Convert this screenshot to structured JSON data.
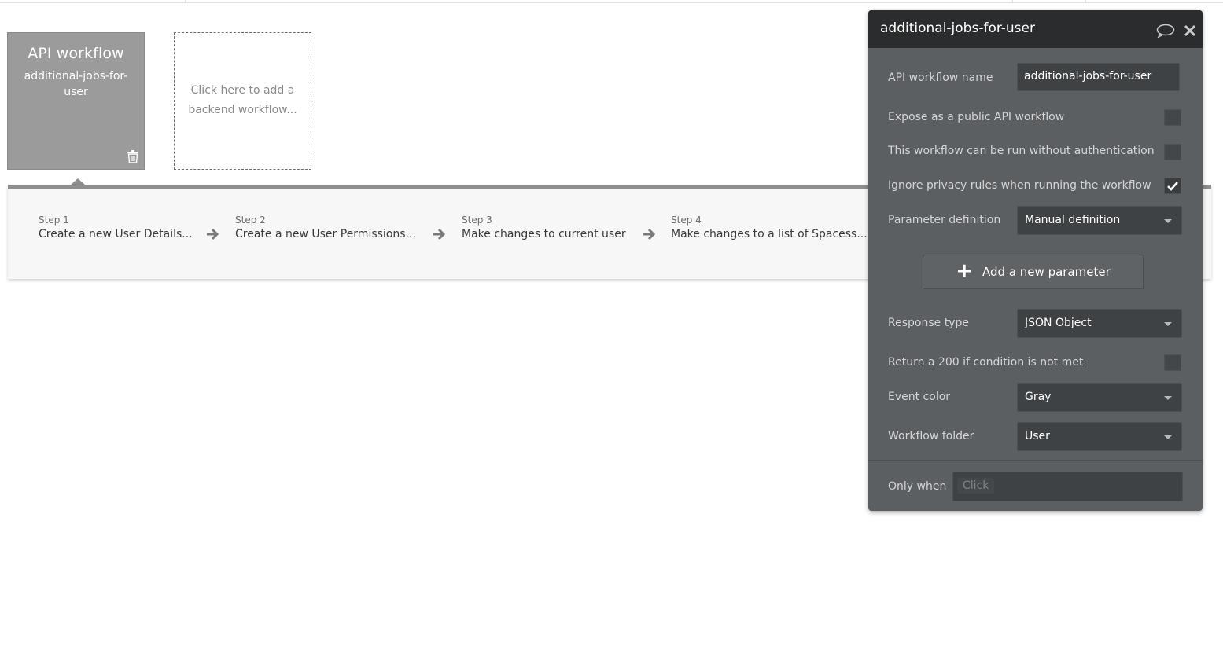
{
  "workflow_card": {
    "title": "API workflow",
    "name": "additional-jobs-for-user"
  },
  "add_card": {
    "label": "Click here to add a backend workflow..."
  },
  "steps": [
    {
      "num": "Step 1",
      "text": "Create a new User Details..."
    },
    {
      "num": "Step 2",
      "text": "Create a new User Permissions..."
    },
    {
      "num": "Step 3",
      "text": "Make changes to current user"
    },
    {
      "num": "Step 4",
      "text": "Make changes to a list of Spacess..."
    }
  ],
  "panel": {
    "title": "additional-jobs-for-user",
    "name_label": "API workflow name",
    "name_value": "additional-jobs-for-user",
    "expose_label": "Expose as a public API workflow",
    "expose_checked": false,
    "no_auth_label": "This workflow can be run without authentication",
    "no_auth_checked": false,
    "privacy_label": "Ignore privacy rules when running the workflow",
    "privacy_checked": true,
    "param_def_label": "Parameter definition",
    "param_def_value": "Manual definition",
    "add_param_label": "Add a new parameter",
    "response_label": "Response type",
    "response_value": "JSON Object",
    "return200_label": "Return a 200 if condition is not met",
    "return200_checked": false,
    "event_color_label": "Event color",
    "event_color_value": "Gray",
    "folder_label": "Workflow folder",
    "folder_value": "User",
    "only_when_label": "Only when",
    "only_when_placeholder": "Click"
  },
  "colors": {
    "panel_bg": "#5c5f62",
    "panel_header": "#2a2c2e",
    "card_gray": "#9b9b9b",
    "step_bar_border": "#8e8e8e"
  }
}
